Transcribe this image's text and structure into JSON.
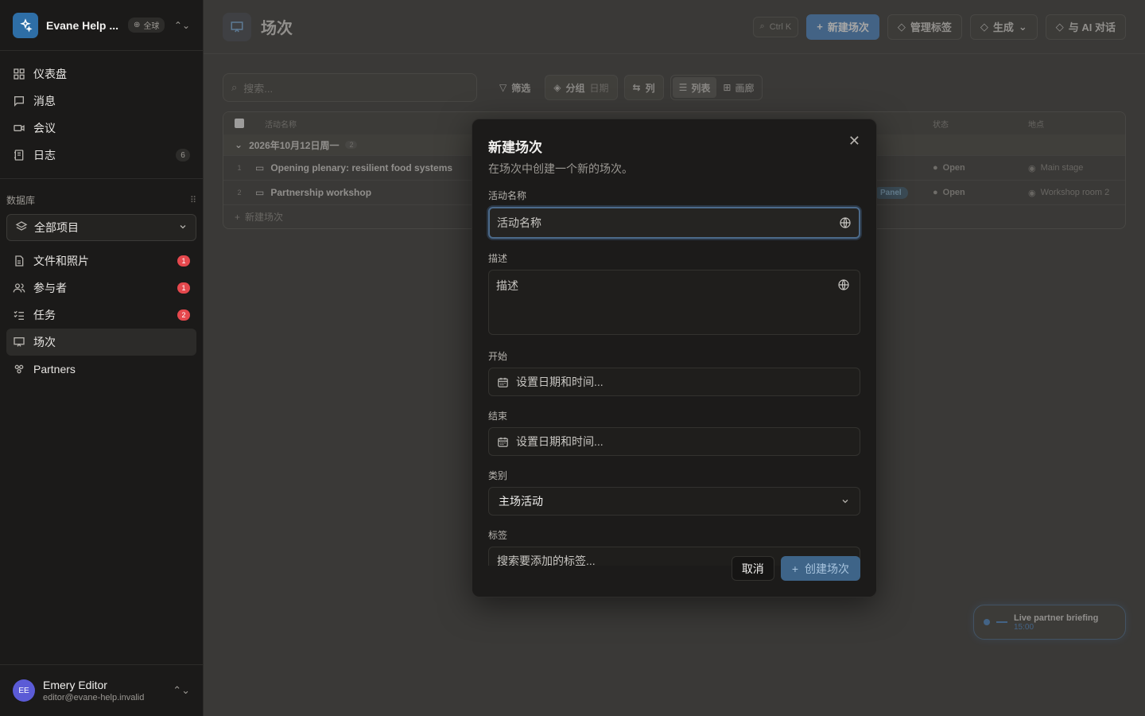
{
  "workspace": {
    "name": "Evane Help ...",
    "badge": "全球"
  },
  "nav": {
    "items": [
      {
        "label": "仪表盘"
      },
      {
        "label": "消息"
      },
      {
        "label": "会议"
      },
      {
        "label": "日志",
        "count": "6"
      }
    ]
  },
  "database": {
    "section_label": "数据库",
    "selector": "全部项目",
    "items": [
      {
        "label": "文件和照片",
        "badge": "1"
      },
      {
        "label": "参与者",
        "badge": "1"
      },
      {
        "label": "任务",
        "badge": "2"
      },
      {
        "label": "场次"
      },
      {
        "label": "Partners"
      }
    ]
  },
  "user": {
    "initials": "EE",
    "name": "Emery Editor",
    "email": "editor@evane-help.invalid"
  },
  "page": {
    "title": "场次"
  },
  "top_actions": {
    "shortcut": "Ctrl K",
    "new_session": "新建场次",
    "manage_tags": "管理标签",
    "generate": "生成",
    "ai_chat": "与 AI 对话"
  },
  "toolbar": {
    "search_placeholder": "搜索...",
    "filter": "筛选",
    "group": "分组",
    "group_value": "日期",
    "columns": "列",
    "view_list": "列表",
    "view_gallery": "画廊"
  },
  "table": {
    "headers": {
      "name": "活动名称",
      "status": "状态",
      "location": "地点"
    },
    "group": {
      "label": "2026年10月12日周一",
      "count": "2"
    },
    "rows": [
      {
        "index": "1",
        "name": "Opening plenary: resilient food systems",
        "status": "Open",
        "location": "Main stage"
      },
      {
        "index": "2",
        "name": "Partnership workshop",
        "category": "Panel",
        "status": "Open",
        "location": "Workshop room 2"
      }
    ],
    "add_label": "新建场次"
  },
  "toast": {
    "title": "Live partner briefing",
    "time": "15:00"
  },
  "modal": {
    "title": "新建场次",
    "description": "在场次中创建一个新的场次。",
    "name_label": "活动名称",
    "name_placeholder": "活动名称",
    "desc_label": "描述",
    "desc_placeholder": "描述",
    "start_label": "开始",
    "start_placeholder": "设置日期和时间...",
    "end_label": "结束",
    "end_placeholder": "设置日期和时间...",
    "category_label": "类别",
    "category_value": "主场活动",
    "tags_label": "标签",
    "tags_placeholder": "搜索要添加的标签...",
    "cancel": "取消",
    "create": "创建场次"
  },
  "colors": {
    "accent": "#4c86c6",
    "badge_red": "#e5484d",
    "avatar": "#5b5bd6"
  }
}
